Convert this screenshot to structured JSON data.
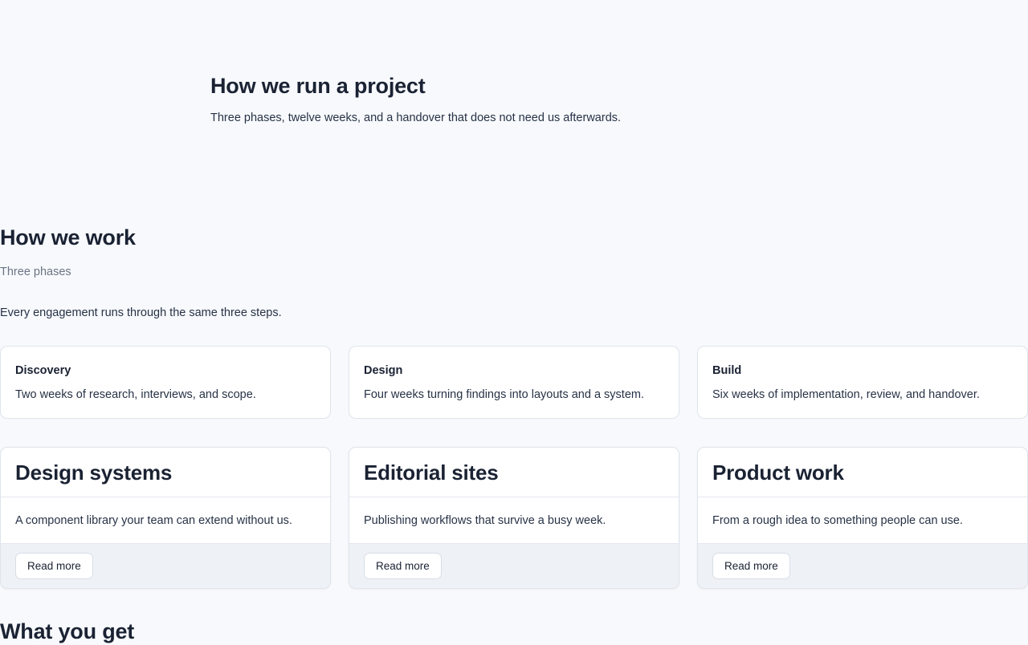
{
  "hero": {
    "title": "How we run a project",
    "subtitle": "Three phases, twelve weeks, and a handover that does not need us afterwards."
  },
  "how_we_work": {
    "title": "How we work",
    "eyebrow": "Three phases",
    "intro": "Every engagement runs through the same three steps.",
    "phases": [
      {
        "title": "Discovery",
        "description": "Two weeks of research, interviews, and scope."
      },
      {
        "title": "Design",
        "description": "Four weeks turning findings into layouts and a system."
      },
      {
        "title": "Build",
        "description": "Six weeks of implementation, review, and handover."
      }
    ]
  },
  "services": [
    {
      "title": "Design systems",
      "description": "A component library your team can extend without us.",
      "button": "Read more"
    },
    {
      "title": "Editorial sites",
      "description": "Publishing workflows that survive a busy week.",
      "button": "Read more"
    },
    {
      "title": "Product work",
      "description": "From a rough idea to something people can use.",
      "button": "Read more"
    }
  ],
  "what_you_get": {
    "title": "What you get"
  }
}
